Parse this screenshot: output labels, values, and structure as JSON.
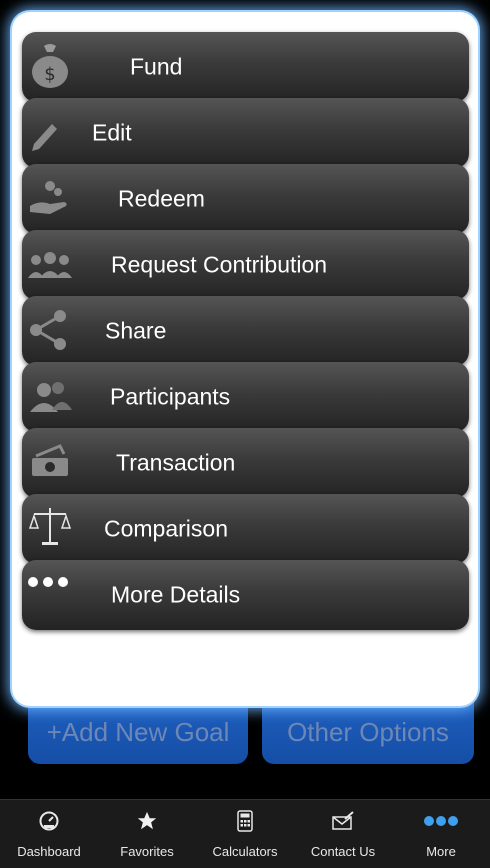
{
  "background": {
    "add_goal_label": "+Add New Goal",
    "other_options_label": "Other Options"
  },
  "menu": {
    "items": [
      {
        "label": "Fund",
        "icon": "money-bag-icon"
      },
      {
        "label": "Edit",
        "icon": "pencil-icon"
      },
      {
        "label": "Redeem",
        "icon": "hand-coins-icon"
      },
      {
        "label": "Request Contribution",
        "icon": "people-group-icon"
      },
      {
        "label": "Share",
        "icon": "share-icon"
      },
      {
        "label": "Participants",
        "icon": "participants-icon"
      },
      {
        "label": "Transaction",
        "icon": "cash-icon"
      },
      {
        "label": "Comparison",
        "icon": "scales-icon"
      },
      {
        "label": "More Details",
        "icon": "ellipsis-icon"
      }
    ]
  },
  "tabbar": {
    "items": [
      {
        "label": "Dashboard",
        "icon": "gauge-icon"
      },
      {
        "label": "Favorites",
        "icon": "star-icon"
      },
      {
        "label": "Calculators",
        "icon": "calculator-icon"
      },
      {
        "label": "Contact Us",
        "icon": "envelope-icon"
      },
      {
        "label": "More",
        "icon": "more-dots-icon",
        "active_color": "#3fa0f0"
      }
    ]
  }
}
